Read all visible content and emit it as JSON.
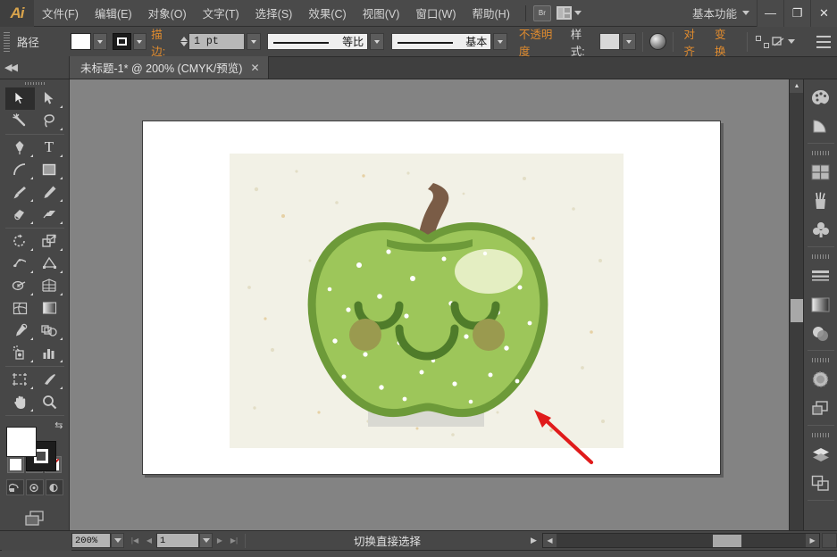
{
  "app": {
    "name": "Ai",
    "logo_icon": "illustrator-logo-icon"
  },
  "menubar": {
    "items": [
      {
        "label": "文件(F)",
        "name": "menu-file"
      },
      {
        "label": "编辑(E)",
        "name": "menu-edit"
      },
      {
        "label": "对象(O)",
        "name": "menu-object"
      },
      {
        "label": "文字(T)",
        "name": "menu-type"
      },
      {
        "label": "选择(S)",
        "name": "menu-select"
      },
      {
        "label": "效果(C)",
        "name": "menu-effect"
      },
      {
        "label": "视图(V)",
        "name": "menu-view"
      },
      {
        "label": "窗口(W)",
        "name": "menu-window"
      },
      {
        "label": "帮助(H)",
        "name": "menu-help"
      }
    ],
    "bridge_label": "Br",
    "workspace_label": "基本功能",
    "window_controls": {
      "minimize": "—",
      "maximize": "❐",
      "close": "✕"
    }
  },
  "controlbar": {
    "context_label": "路径",
    "stroke_label": "描边:",
    "stroke_weight": "1 pt",
    "profile_uniform": "等比",
    "brush_basic": "基本",
    "opacity_label": "不透明度",
    "style_label": "样式:",
    "align_label": "对齐",
    "transform_label": "变换"
  },
  "tabbar": {
    "document_title": "未标题-1* @ 200% (CMYK/预览)",
    "close_glyph": "✕"
  },
  "toolbar": {
    "tools": [
      {
        "name": "selection-tool",
        "glyph": "selection",
        "selected": true
      },
      {
        "name": "direct-selection-tool",
        "glyph": "direct-selection",
        "selected": false
      },
      {
        "name": "magic-wand-tool",
        "glyph": "magic-wand",
        "selected": false
      },
      {
        "name": "lasso-tool",
        "glyph": "lasso",
        "selected": false
      },
      {
        "name": "pen-tool",
        "glyph": "pen",
        "selected": false
      },
      {
        "name": "type-tool",
        "glyph": "T",
        "selected": false
      },
      {
        "name": "line-segment-tool",
        "glyph": "arc",
        "selected": false
      },
      {
        "name": "rectangle-tool",
        "glyph": "rectangle",
        "selected": false
      },
      {
        "name": "paintbrush-tool",
        "glyph": "paintbrush",
        "selected": false
      },
      {
        "name": "pencil-tool",
        "glyph": "pencil",
        "selected": false
      },
      {
        "name": "blob-brush-tool",
        "glyph": "blob-brush",
        "selected": false
      },
      {
        "name": "eraser-tool",
        "glyph": "eraser",
        "selected": false
      },
      {
        "name": "rotate-tool",
        "glyph": "rotate",
        "selected": false
      },
      {
        "name": "scale-tool",
        "glyph": "scale",
        "selected": false
      },
      {
        "name": "width-tool",
        "glyph": "width",
        "selected": false
      },
      {
        "name": "free-transform-tool",
        "glyph": "free-transform",
        "selected": false
      },
      {
        "name": "shape-builder-tool",
        "glyph": "shape-builder",
        "selected": false
      },
      {
        "name": "perspective-grid-tool",
        "glyph": "perspective-grid",
        "selected": false
      },
      {
        "name": "mesh-tool",
        "glyph": "mesh",
        "selected": false
      },
      {
        "name": "gradient-tool",
        "glyph": "gradient",
        "selected": false
      },
      {
        "name": "eyedropper-tool",
        "glyph": "eyedropper",
        "selected": false
      },
      {
        "name": "blend-tool",
        "glyph": "blend",
        "selected": false
      },
      {
        "name": "symbol-sprayer-tool",
        "glyph": "symbol-sprayer",
        "selected": false
      },
      {
        "name": "column-graph-tool",
        "glyph": "column-graph",
        "selected": false
      },
      {
        "name": "artboard-tool",
        "glyph": "artboard",
        "selected": false
      },
      {
        "name": "slice-tool",
        "glyph": "slice",
        "selected": false
      },
      {
        "name": "hand-tool",
        "glyph": "hand",
        "selected": false
      },
      {
        "name": "zoom-tool",
        "glyph": "zoom",
        "selected": false
      }
    ],
    "fill_color": "#ffffff",
    "stroke_color": "#1d1d1d",
    "fill_modes": [
      "color-fill",
      "gradient-fill",
      "none-fill"
    ],
    "screen_modes": [
      "normal-screen-mode",
      "full-screen-with-menu",
      "full-screen-mode"
    ]
  },
  "dock": {
    "panels": [
      {
        "name": "panel-color",
        "glyph": "palette-icon"
      },
      {
        "name": "panel-color-guide",
        "glyph": "color-guide-icon"
      },
      {
        "name": "panel-swatches",
        "glyph": "swatches-icon"
      },
      {
        "name": "panel-brushes",
        "glyph": "brushes-icon"
      },
      {
        "name": "panel-symbols",
        "glyph": "symbols-icon"
      },
      {
        "name": "panel-stroke",
        "glyph": "stroke-icon"
      },
      {
        "name": "panel-gradient",
        "glyph": "gradient-icon"
      },
      {
        "name": "panel-transparency",
        "glyph": "transparency-icon"
      },
      {
        "name": "panel-appearance",
        "glyph": "appearance-icon"
      },
      {
        "name": "panel-graphic-styles",
        "glyph": "graphic-styles-icon"
      },
      {
        "name": "panel-layers",
        "glyph": "layers-icon"
      },
      {
        "name": "panel-artboards",
        "glyph": "artboards-icon"
      }
    ]
  },
  "statusbar": {
    "zoom_level": "200%",
    "page_number": "1",
    "status_text": "切换直接选择"
  },
  "artwork": {
    "title": "kawaii-green-apple",
    "background_color": "#f2f1e6",
    "apple_body_color": "#9dc65a",
    "apple_outline_color": "#6d9a39",
    "stem_color": "#7a5c46",
    "cheek_color": "#9a9a4f",
    "highlight_color": "#e4eec2",
    "shadow_color": "#d9d9d2",
    "annotation_arrow_color": "#e01b1b"
  }
}
